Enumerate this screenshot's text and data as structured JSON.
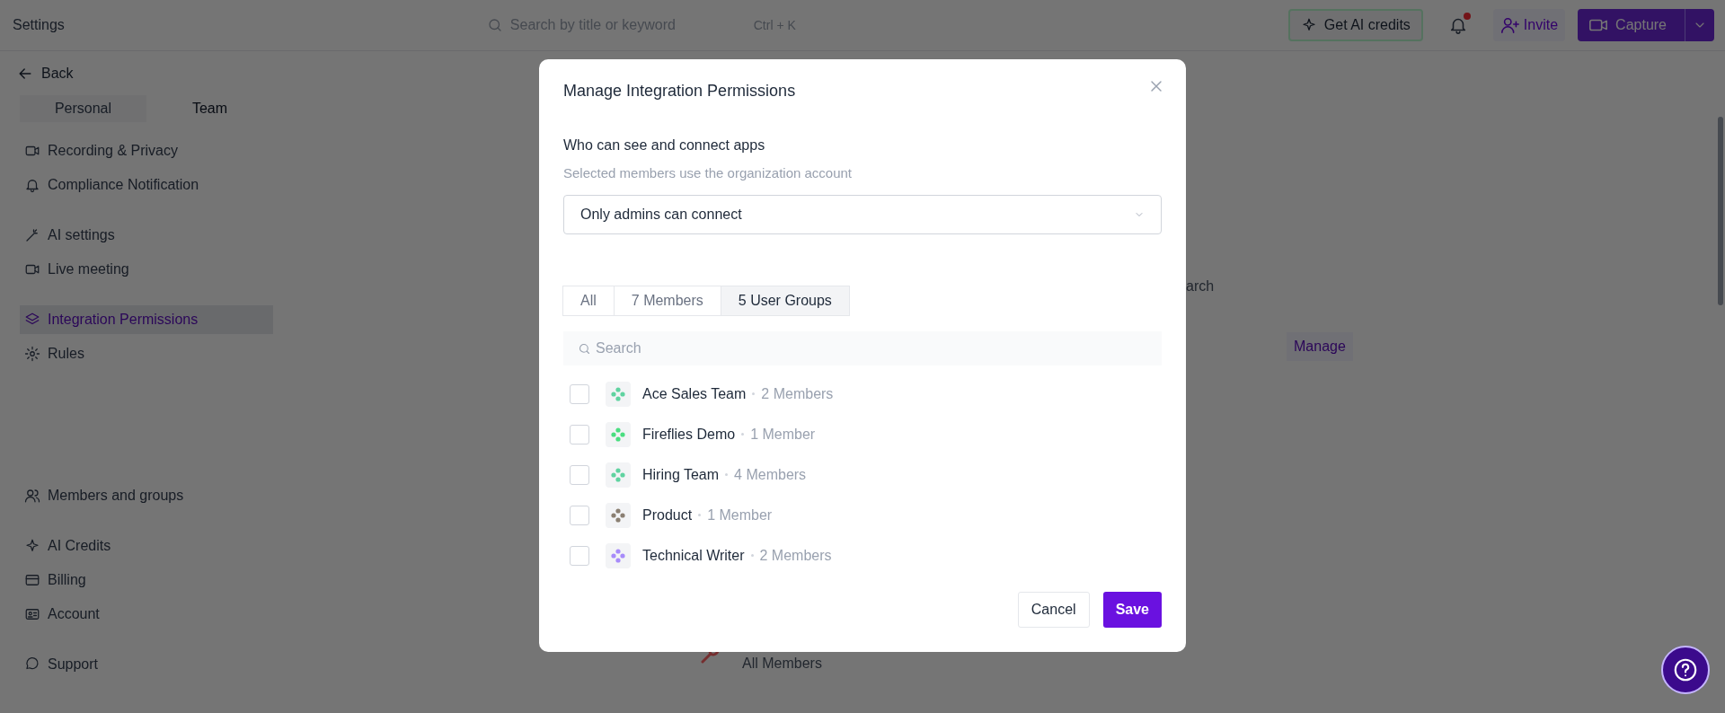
{
  "top_bar": {
    "title": "Settings",
    "search": {
      "placeholder": "Search by title or keyword",
      "shortcut": "Ctrl + K"
    },
    "credits_button": "Get AI credits",
    "notifications": {
      "unread": true
    },
    "invite_button": "Invite",
    "capture_button": "Capture"
  },
  "sidebar": {
    "back": "Back",
    "scope_tabs": [
      {
        "label": "Personal",
        "selected": false
      },
      {
        "label": "Team",
        "selected": true
      }
    ],
    "sections": [
      [
        {
          "label": "Recording & Privacy",
          "selected": false
        },
        {
          "label": "Compliance Notification",
          "selected": false
        }
      ],
      [
        {
          "label": "AI settings",
          "selected": false
        },
        {
          "label": "Live meeting",
          "selected": false
        }
      ],
      [
        {
          "label": "Integration Permissions",
          "selected": true
        },
        {
          "label": "Rules",
          "selected": false
        }
      ],
      [
        {
          "label": "Members and groups",
          "selected": false
        }
      ],
      [
        {
          "label": "AI Credits",
          "selected": false
        },
        {
          "label": "Billing",
          "selected": false
        },
        {
          "label": "Account",
          "selected": false
        }
      ],
      [
        {
          "label": "Support",
          "selected": false
        }
      ]
    ]
  },
  "background": {
    "search_fragment": "arch",
    "manage_button": "Manage",
    "list_item": "All Members"
  },
  "modal": {
    "title": "Manage Integration Permissions",
    "question": "Who can see and connect apps",
    "hint": "Selected members use the organization account",
    "select_value": "Only admins can connect",
    "tabs": [
      {
        "label": "All",
        "selected": false
      },
      {
        "label": "7 Members",
        "selected": false
      },
      {
        "label": "5 User Groups",
        "selected": true
      }
    ],
    "search": {
      "placeholder": "Search"
    },
    "groups": [
      {
        "name": "Ace Sales Team",
        "count": "2 Members",
        "color": "#5fd3a0",
        "checked": false
      },
      {
        "name": "Fireflies Demo",
        "count": "1 Member",
        "color": "#4ade80",
        "checked": false
      },
      {
        "name": "Hiring Team",
        "count": "4 Members",
        "color": "#5fd3a0",
        "checked": false
      },
      {
        "name": "Product",
        "count": "1 Member",
        "color": "#8a7f72",
        "checked": false
      },
      {
        "name": "Technical Writer",
        "count": "2 Members",
        "color": "#a78bfa",
        "checked": false
      }
    ],
    "cancel_button": "Cancel",
    "save_button": "Save"
  }
}
